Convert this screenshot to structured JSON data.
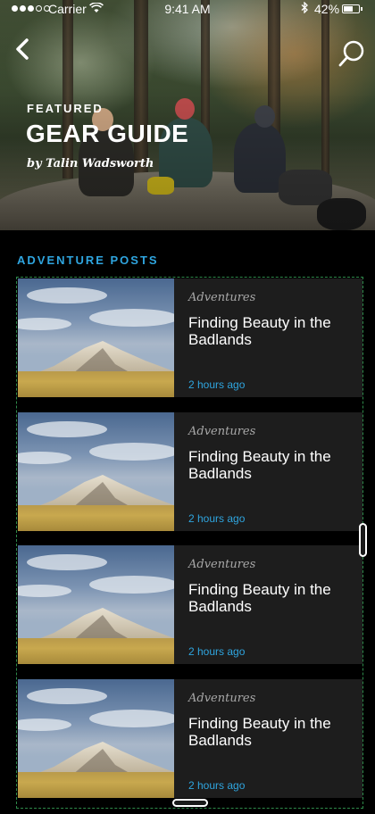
{
  "status_bar": {
    "carrier": "Carrier",
    "time": "9:41 AM",
    "battery": "42%"
  },
  "hero": {
    "eyebrow": "FEATURED",
    "title": "GEAR GUIDE",
    "byline": "by Talin Wadsworth"
  },
  "section": {
    "title": "ADVENTURE POSTS"
  },
  "posts": [
    {
      "category": "Adventures",
      "title": "Finding Beauty in the Badlands",
      "time": "2 hours ago"
    },
    {
      "category": "Adventures",
      "title": "Finding Beauty in the Badlands",
      "time": "2 hours ago"
    },
    {
      "category": "Adventures",
      "title": "Finding Beauty in the Badlands",
      "time": "2 hours ago"
    },
    {
      "category": "Adventures",
      "title": "Finding Beauty in the Badlands",
      "time": "2 hours ago"
    }
  ],
  "icons": {
    "back": "chevron-left-icon",
    "search": "search-icon",
    "wifi": "wifi-icon",
    "bluetooth": "bluetooth-icon",
    "battery": "battery-icon"
  },
  "colors": {
    "accent": "#2fa5df",
    "card_bg": "#1d1d1d",
    "page_bg": "#000000"
  }
}
